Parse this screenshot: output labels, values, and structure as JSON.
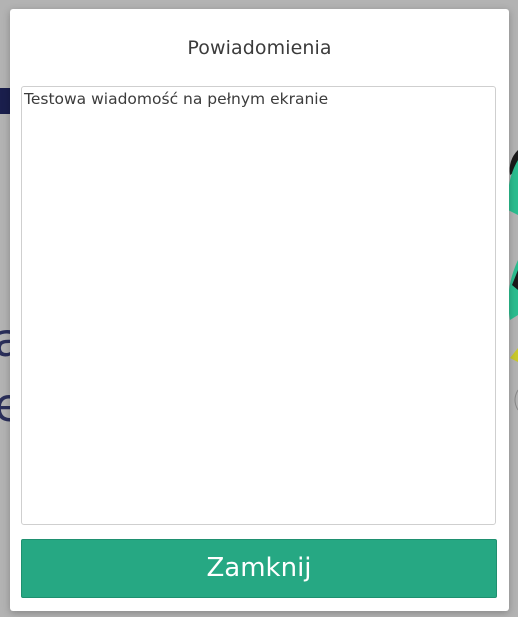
{
  "modal": {
    "title": "Powiadomienia",
    "message": "Testowa wiadomość na pełnym ekranie",
    "close_label": "Zamknij"
  },
  "background": {
    "glyph_a": "a",
    "glyph_e": "e"
  },
  "colors": {
    "accent": "#26a883",
    "overlay": "#b3b3b3",
    "navbar": "#1a1f4d"
  }
}
